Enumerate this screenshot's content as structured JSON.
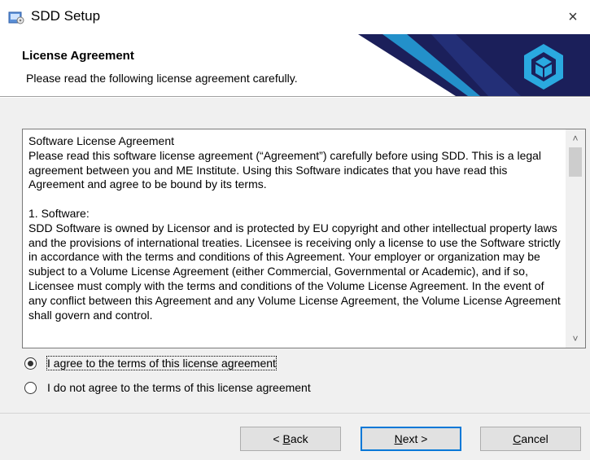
{
  "window": {
    "title": "SDD Setup",
    "close_glyph": "×",
    "app_icon": "setup-installer-icon"
  },
  "header": {
    "title": "License Agreement",
    "subtitle": "Please read the following license agreement carefully.",
    "logo_icon": "box-3d-icon",
    "colors": {
      "dark_banner": "#1b1f5a",
      "accent": "#2aa9e0"
    }
  },
  "license": {
    "text": "Software License Agreement\nPlease read this software license agreement (“Agreement”) carefully before using SDD. This is a legal agreement between you and ME Institute. Using this Software indicates that you have read this Agreement and agree to be bound by its terms.\n\n1. Software:\nSDD Software is owned by Licensor and is protected by EU copyright and other intellectual property laws and the provisions of international treaties. Licensee is receiving only a license to use the Software strictly in accordance with the terms and conditions of this Agreement. Your employer or organization may be subject to a Volume License Agreement (either Commercial, Governmental or Academic), and if so, Licensee must comply with the terms and conditions of the Volume License Agreement. In the event of any conflict between this Agreement and any Volume License Agreement, the Volume License Agreement shall govern and control.",
    "scroll_up_glyph": "˄",
    "scroll_down_glyph": "˅"
  },
  "options": {
    "agree_label": "I agree to the terms of this license agreement",
    "disagree_label": "I do not agree to the terms of this license agreement",
    "selected": "agree"
  },
  "buttons": {
    "back_prefix": "< ",
    "back_key": "B",
    "back_rest": "ack",
    "next_key": "N",
    "next_rest": "ext >",
    "cancel_key": "C",
    "cancel_rest": "ancel"
  }
}
